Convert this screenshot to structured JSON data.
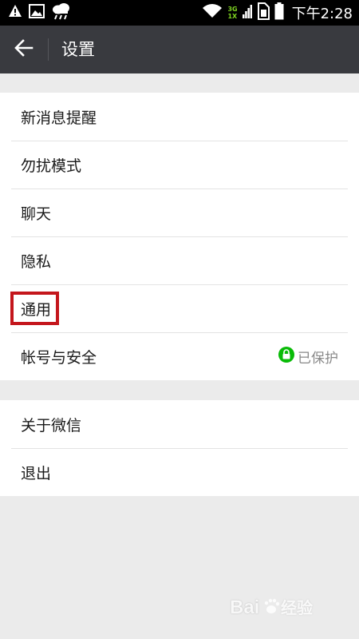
{
  "status_bar": {
    "time": "下午2:28",
    "network": [
      "3G",
      "1X"
    ],
    "icons": [
      "warning-icon",
      "image-icon",
      "cloud-rain-icon",
      "wifi-icon",
      "signal-icon",
      "sim-icon",
      "battery-icon"
    ]
  },
  "app_bar": {
    "title": "设置",
    "back_icon": "arrow-left-icon",
    "background": "#393a3f"
  },
  "settings": {
    "group1": [
      {
        "label": "新消息提醒"
      },
      {
        "label": "勿扰模式"
      },
      {
        "label": "聊天"
      },
      {
        "label": "隐私"
      },
      {
        "label": "通用"
      },
      {
        "label": "帐号与安全",
        "badge": "已保护",
        "badge_icon": "lock-icon"
      }
    ],
    "group2": [
      {
        "label": "关于微信"
      },
      {
        "label": "退出"
      }
    ]
  },
  "colors": {
    "highlight": "#c4161c",
    "badge_green": "#09bb07"
  }
}
